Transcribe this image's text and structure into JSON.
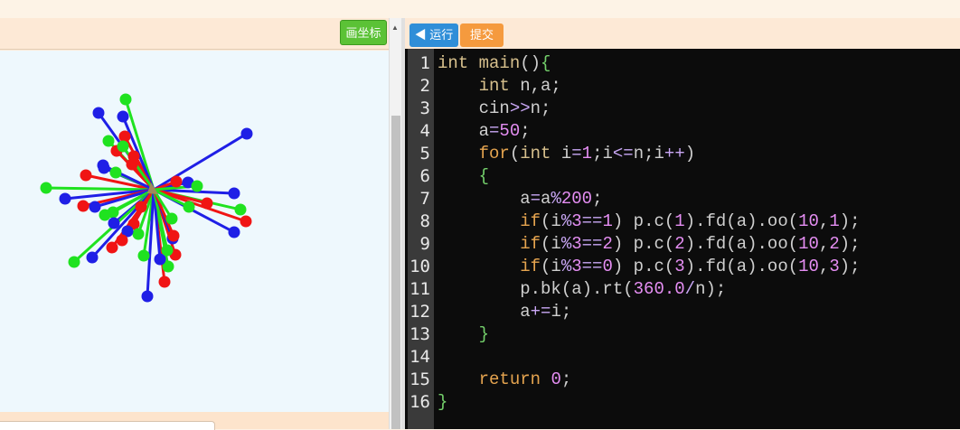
{
  "toolbar_left": {
    "axis_button": "画坐标"
  },
  "toolbar_right": {
    "run_button": "◀ 运行",
    "submit_button": "提交"
  },
  "editor": {
    "line_numbers": [
      "1",
      "2",
      "3",
      "4",
      "5",
      "6",
      "7",
      "8",
      "9",
      "10",
      "11",
      "12",
      "13",
      "14",
      "15",
      "16"
    ],
    "lines": [
      [
        [
          "kw",
          "int"
        ],
        [
          "tx",
          " "
        ],
        [
          "kw",
          "main"
        ],
        [
          "tx",
          "()"
        ],
        [
          "br",
          "{"
        ]
      ],
      [
        [
          "tx",
          "    "
        ],
        [
          "kw",
          "int"
        ],
        [
          "tx",
          " n,a;"
        ]
      ],
      [
        [
          "tx",
          "    cin"
        ],
        [
          "op",
          ">>"
        ],
        [
          "tx",
          "n;"
        ]
      ],
      [
        [
          "tx",
          "    a"
        ],
        [
          "op",
          "="
        ],
        [
          "num",
          "50"
        ],
        [
          "tx",
          ";"
        ]
      ],
      [
        [
          "tx",
          "    "
        ],
        [
          "kc",
          "for"
        ],
        [
          "tx",
          "("
        ],
        [
          "kw",
          "int"
        ],
        [
          "tx",
          " i"
        ],
        [
          "op",
          "="
        ],
        [
          "num",
          "1"
        ],
        [
          "tx",
          ";i"
        ],
        [
          "op",
          "<="
        ],
        [
          "tx",
          "n;i"
        ],
        [
          "op",
          "++"
        ],
        [
          "tx",
          ")"
        ]
      ],
      [
        [
          "tx",
          "    "
        ],
        [
          "br",
          "{"
        ]
      ],
      [
        [
          "tx",
          "        a"
        ],
        [
          "op",
          "="
        ],
        [
          "tx",
          "a"
        ],
        [
          "op",
          "%"
        ],
        [
          "num",
          "200"
        ],
        [
          "tx",
          ";"
        ]
      ],
      [
        [
          "tx",
          "        "
        ],
        [
          "kc",
          "if"
        ],
        [
          "tx",
          "(i"
        ],
        [
          "op",
          "%"
        ],
        [
          "num",
          "3"
        ],
        [
          "op",
          "=="
        ],
        [
          "num",
          "1"
        ],
        [
          "tx",
          ") p.c("
        ],
        [
          "num",
          "1"
        ],
        [
          "tx",
          ").fd(a).oo("
        ],
        [
          "num",
          "10"
        ],
        [
          "tx",
          ","
        ],
        [
          "num",
          "1"
        ],
        [
          "tx",
          ");"
        ]
      ],
      [
        [
          "tx",
          "        "
        ],
        [
          "kc",
          "if"
        ],
        [
          "tx",
          "(i"
        ],
        [
          "op",
          "%"
        ],
        [
          "num",
          "3"
        ],
        [
          "op",
          "=="
        ],
        [
          "num",
          "2"
        ],
        [
          "tx",
          ") p.c("
        ],
        [
          "num",
          "2"
        ],
        [
          "tx",
          ").fd(a).oo("
        ],
        [
          "num",
          "10"
        ],
        [
          "tx",
          ","
        ],
        [
          "num",
          "2"
        ],
        [
          "tx",
          ");"
        ]
      ],
      [
        [
          "tx",
          "        "
        ],
        [
          "kc",
          "if"
        ],
        [
          "tx",
          "(i"
        ],
        [
          "op",
          "%"
        ],
        [
          "num",
          "3"
        ],
        [
          "op",
          "=="
        ],
        [
          "num",
          "0"
        ],
        [
          "tx",
          ") p.c("
        ],
        [
          "num",
          "3"
        ],
        [
          "tx",
          ").fd(a).oo("
        ],
        [
          "num",
          "10"
        ],
        [
          "tx",
          ","
        ],
        [
          "num",
          "3"
        ],
        [
          "tx",
          ");"
        ]
      ],
      [
        [
          "tx",
          "        p.bk(a).rt("
        ],
        [
          "num",
          "360.0"
        ],
        [
          "op",
          "/"
        ],
        [
          "tx",
          "n);"
        ]
      ],
      [
        [
          "tx",
          "        a"
        ],
        [
          "op",
          "+="
        ],
        [
          "tx",
          "i;"
        ]
      ],
      [
        [
          "tx",
          "    "
        ],
        [
          "br",
          "}"
        ]
      ],
      [
        [
          "tx",
          ""
        ]
      ],
      [
        [
          "tx",
          "    "
        ],
        [
          "kc",
          "return"
        ],
        [
          "tx",
          " "
        ],
        [
          "num",
          "0"
        ],
        [
          "tx",
          ";"
        ]
      ],
      [
        [
          "br",
          "}"
        ]
      ]
    ]
  },
  "canvas": {
    "colors": [
      "#1f1fe6",
      "#f01414",
      "#1fe21f"
    ],
    "rays": [
      [
        1,
        103,
        -62
      ],
      [
        2,
        -32,
        -59
      ],
      [
        3,
        -31,
        -100
      ],
      [
        1,
        -34,
        -81
      ],
      [
        2,
        -22,
        -37
      ],
      [
        3,
        -50,
        -54
      ],
      [
        1,
        -55,
        -24
      ],
      [
        2,
        -41,
        -43
      ],
      [
        3,
        -42,
        -19
      ],
      [
        1,
        -61,
        -85
      ],
      [
        2,
        -75,
        -16
      ],
      [
        3,
        -119,
        -2
      ],
      [
        1,
        -56,
        -27
      ],
      [
        2,
        -24,
        -28
      ],
      [
        3,
        -34,
        -48
      ],
      [
        1,
        -98,
        10
      ],
      [
        2,
        -78,
        18
      ],
      [
        3,
        -45,
        25
      ],
      [
        1,
        -65,
        19
      ],
      [
        2,
        -14,
        19
      ],
      [
        3,
        -54,
        28
      ],
      [
        1,
        -44,
        37
      ],
      [
        2,
        -22,
        38
      ],
      [
        3,
        -17,
        49
      ],
      [
        1,
        -29,
        46
      ],
      [
        2,
        -35,
        56
      ],
      [
        3,
        -88,
        80
      ],
      [
        1,
        -68,
        75
      ],
      [
        2,
        -46,
        64
      ],
      [
        3,
        -11,
        73
      ],
      [
        1,
        -7,
        118
      ],
      [
        2,
        12,
        102
      ],
      [
        3,
        16,
        85
      ],
      [
        1,
        7,
        77
      ],
      [
        2,
        24,
        72
      ],
      [
        3,
        15,
        67
      ],
      [
        1,
        21,
        54
      ],
      [
        2,
        22,
        51
      ],
      [
        3,
        20,
        32
      ],
      [
        1,
        89,
        47
      ],
      [
        2,
        102,
        35
      ],
      [
        3,
        96,
        22
      ],
      [
        1,
        89,
        4
      ],
      [
        2,
        59,
        15
      ],
      [
        3,
        39,
        19
      ],
      [
        1,
        38,
        -8
      ],
      [
        2,
        25,
        -9
      ],
      [
        3,
        48,
        -4
      ]
    ]
  }
}
